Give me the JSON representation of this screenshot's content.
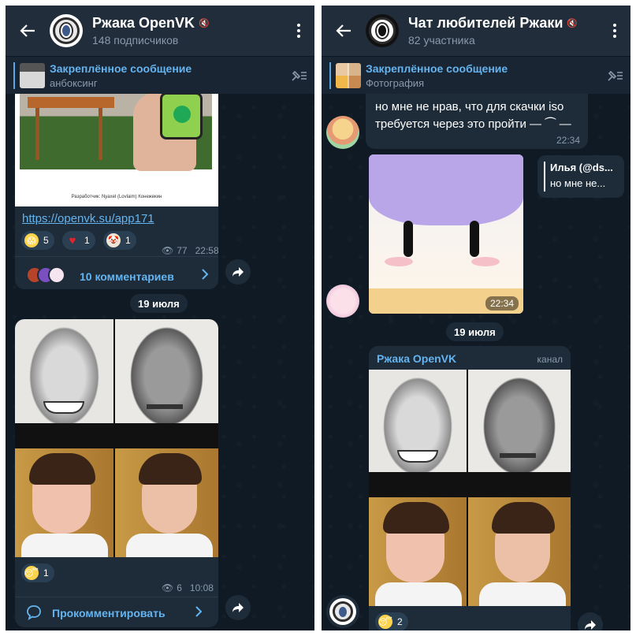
{
  "left": {
    "header": {
      "title": "Ржака OpenVK",
      "subtitle": "148 подписчиков"
    },
    "pinned": {
      "title": "Закреплённое сообщение",
      "subtitle": "анбоксинг"
    },
    "post1": {
      "caption": "Разработчик: Nyaxel (Lovlaim) Конежекин",
      "link": "https://openvk.su/app171",
      "reactions": [
        {
          "icon": "scream-emoji-icon",
          "count": "5"
        },
        {
          "icon": "heart-emoji-icon",
          "count": "1"
        },
        {
          "icon": "clown-emoji-icon",
          "count": "1"
        }
      ],
      "views": "77",
      "time": "22:58",
      "comments": "10 комментариев"
    },
    "date": "19 июля",
    "post2": {
      "reactions": [
        {
          "icon": "sleepy-emoji-icon",
          "count": "1"
        }
      ],
      "views": "6",
      "time": "10:08",
      "comment_action": "Прокомментировать"
    }
  },
  "right": {
    "header": {
      "title": "Чат любителей Ржаки",
      "subtitle": "82 участника"
    },
    "pinned": {
      "title": "Закреплённое сообщение",
      "subtitle": "Фотография"
    },
    "msg1": {
      "text": "но мне не нрав, что для скачки iso требуется через это пройти — ⏜ —",
      "time": "22:34"
    },
    "reply": {
      "author": "Илья (@ds...",
      "text": "но мне не..."
    },
    "msg2": {
      "time": "22:34"
    },
    "date": "19 июля",
    "fwd": {
      "from": "Ржака OpenVK",
      "label": "канал"
    },
    "post": {
      "reactions": [
        {
          "icon": "sleepy-emoji-icon",
          "count": "2"
        }
      ]
    }
  },
  "colors": {
    "accent": "#64b4f0",
    "bg": "#0f1a25",
    "bubble": "#1e2c3a",
    "header": "#212d3b"
  }
}
